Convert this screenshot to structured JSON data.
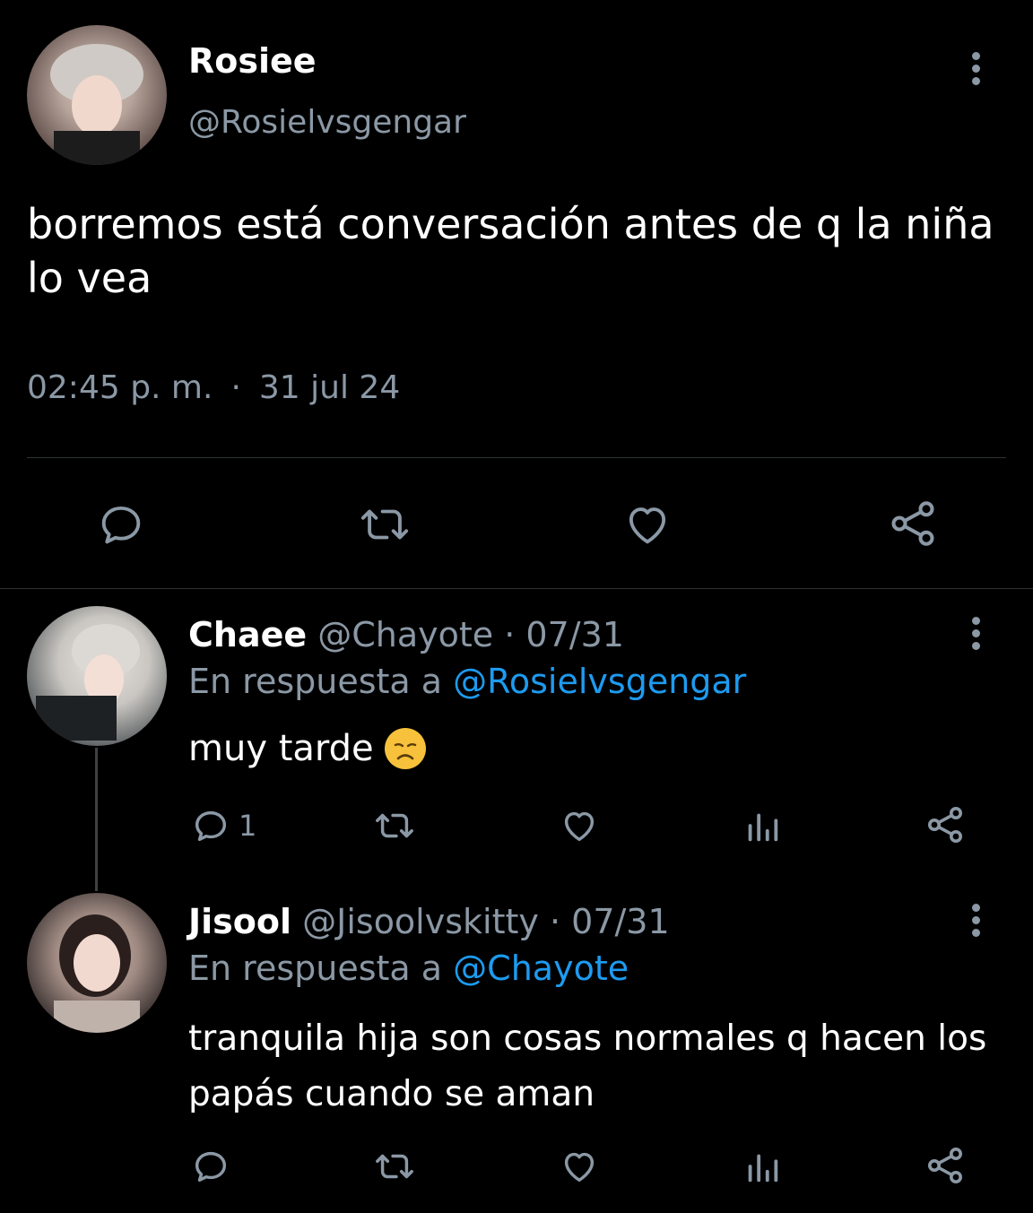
{
  "main_tweet": {
    "display_name": "Rosiee",
    "handle": "@Rosielvsgengar",
    "text_line1": "borremos está conversación antes de q la niña",
    "text_line2": "lo vea",
    "time": "02:45 p. m.",
    "separator": "·",
    "date": "31 jul 24"
  },
  "replies": [
    {
      "display_name": "Chaee",
      "handle": "@Chayote",
      "date": "· 07/31",
      "reply_prefix": "En respuesta a",
      "reply_to": "@Rosielvsgengar",
      "text": "muy tarde",
      "emoji": "😞",
      "reply_count": "1"
    },
    {
      "display_name": "Jisool",
      "handle": "@Jisoolvskitty",
      "date": "· 07/31",
      "reply_prefix": "En respuesta a",
      "reply_to": "@Chayote",
      "text_line1": "tranquila hija son cosas normales q hacen los",
      "text_line2": "papás cuando se aman"
    }
  ],
  "colors": {
    "background": "#000000",
    "text": "#e7e9ea",
    "muted": "#8b98a5",
    "link": "#1d9bf0"
  },
  "icons": [
    "more-vertical-icon",
    "reply-icon",
    "retweet-icon",
    "like-icon",
    "share-icon",
    "views-icon"
  ]
}
